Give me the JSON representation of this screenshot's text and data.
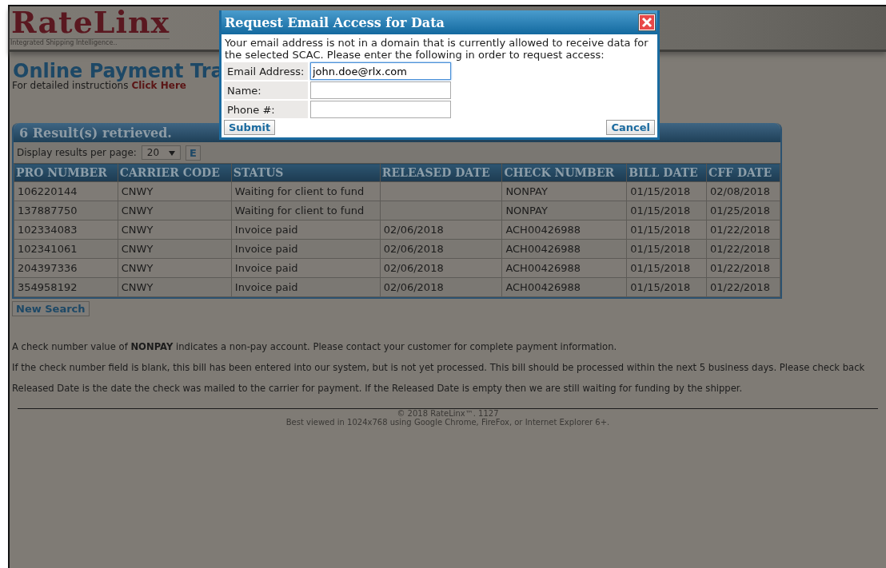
{
  "header": {
    "logo": "RateLinx",
    "tagline": "Integrated Shipping Intelligence.."
  },
  "page": {
    "title": "Online Payment Tra",
    "instructions": "For detailed instructions",
    "instructions_link": "Click Here"
  },
  "results": {
    "heading": "6 Result(s) retrieved.",
    "per_page_label": "Display results per page:",
    "per_page_value": "20",
    "button_partial": "E",
    "table": {
      "columns": [
        "PRO NUMBER",
        "CARRIER CODE",
        "STATUS",
        "RELEASED DATE",
        "CHECK NUMBER",
        "BILL DATE",
        "CFF DATE"
      ],
      "rows": [
        [
          "106220144",
          "CNWY",
          "Waiting for client to fund",
          "",
          "NONPAY",
          "01/15/2018",
          "02/08/2018"
        ],
        [
          "137887750",
          "CNWY",
          "Waiting for client to fund",
          "",
          "NONPAY",
          "01/15/2018",
          "01/25/2018"
        ],
        [
          "102334083",
          "CNWY",
          "Invoice paid",
          "02/06/2018",
          "ACH00426988",
          "01/15/2018",
          "01/22/2018"
        ],
        [
          "102341061",
          "CNWY",
          "Invoice paid",
          "02/06/2018",
          "ACH00426988",
          "01/15/2018",
          "01/22/2018"
        ],
        [
          "204397336",
          "CNWY",
          "Invoice paid",
          "02/06/2018",
          "ACH00426988",
          "01/15/2018",
          "01/22/2018"
        ],
        [
          "354958192",
          "CNWY",
          "Invoice paid",
          "02/06/2018",
          "ACH00426988",
          "01/15/2018",
          "01/22/2018"
        ]
      ]
    },
    "new_search": "New Search"
  },
  "notes": [
    "A check number value of **NONPAY** indicates a non-pay account. Please contact your customer for complete payment information.",
    "If the check number field is blank, this bill has been entered into our system, but is not yet processed. This bill should be processed within the next 5 business days. Please check back",
    "Released Date is the date the check was mailed to the carrier for payment. If the Released Date is empty then we are still waiting for funding by the shipper."
  ],
  "footer": {
    "copyright": "© 2018 RateLinx™.  1127",
    "note": "Best viewed in 1024x768 using Google Chrome, FireFox, or Internet Explorer 6+."
  },
  "dialog": {
    "title": "Request Email Access for Data",
    "message": "Your email address is not in a domain that is currently allowed to receive data for the selected SCAC. Please enter the following in order to request access:",
    "fields": [
      {
        "label": "Email Address:",
        "value": "john.doe@rlx.com",
        "focused": true
      },
      {
        "label": "Name:",
        "focused": false
      },
      {
        "label": "Phone #:",
        "focused": false
      }
    ],
    "submit": "Submit",
    "cancel": "Cancel"
  }
}
